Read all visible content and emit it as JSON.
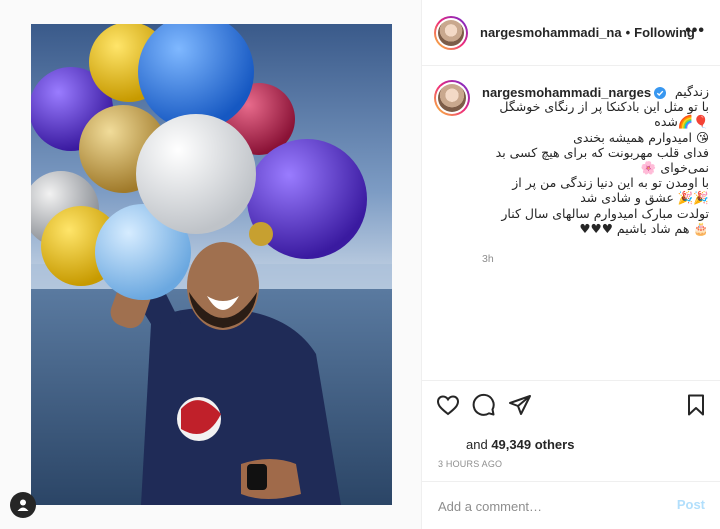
{
  "post": {
    "header_username": "nargesmohammadi_na",
    "separator": "•",
    "follow_state": "Following",
    "more_icon": "more-options-icon",
    "caption_username": "nargesmohammadi_narges",
    "caption_text": "زندگیم\nبا تو مثل این بادکنکا پر از رنگای خوشگل\n🎈🌈شده\n😘 امیدوارم همیشه بخندی\nفدای قلب مهربونت که برای هیچ کسی بد\n نمی‌خوای 🌸\nبا اومدن تو به این دنیا زندگی من پر از\n🎉🎉 عشق و شادی شد\nتولدت مبارک امیدوارم سالهای سال کنار\n🎂 هم شاد باشیم ♥♥♥",
    "caption_time": "3h",
    "likes_prefix": "and ",
    "likes_count": "49,349",
    "likes_suffix": " others",
    "post_date": "3 HOURS AGO",
    "comment_placeholder": "Add a comment…",
    "post_button": "Post"
  },
  "colors": {
    "accent_blue": "#0095f6",
    "post_disabled": "#b2dffc",
    "muted": "#8e8e8e",
    "verified": "#3897f0"
  },
  "icons": [
    "like-icon",
    "comment-icon",
    "share-icon",
    "save-icon",
    "verified-icon",
    "user-icon"
  ]
}
